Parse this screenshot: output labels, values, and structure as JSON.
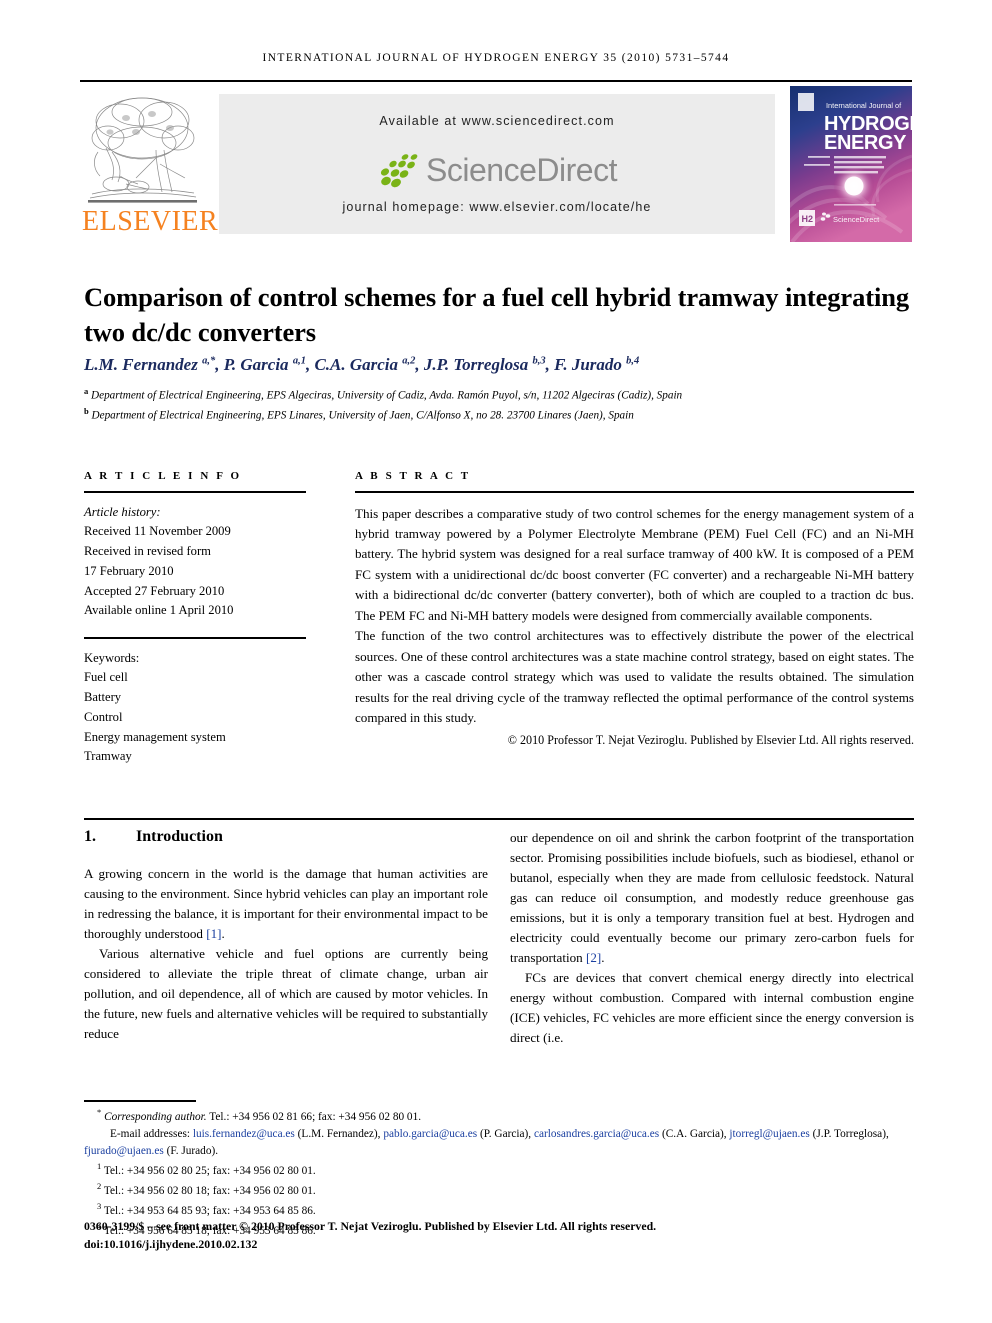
{
  "running_head": "International Journal of Hydrogen Energy 35 (2010) 5731–5744",
  "masthead": {
    "publisher_name": "ELSEVIER",
    "publisher_logo_icon": "elsevier-tree-icon",
    "available_at": "Available at www.sciencedirect.com",
    "sciencedirect_wordmark": "ScienceDirect",
    "sciencedirect_leaves_icon": "sciencedirect-leaves-icon",
    "journal_homepage": "journal homepage: www.elsevier.com/locate/he",
    "cover": {
      "eyebrow": "International Journal of",
      "line1": "HYDROGEN",
      "line2": "ENERGY",
      "badge": "H2",
      "footer_brand": "ScienceDirect"
    }
  },
  "article": {
    "title": "Comparison of control schemes for a fuel cell hybrid tramway integrating two dc/dc converters",
    "authors_html": "L.M. Fernandez <sup>a,*</sup>, P. Garcia <sup>a,1</sup>, C.A. Garcia <sup>a,2</sup>, J.P. Torreglosa <sup>b,3</sup>, F. Jurado <sup>b,4</sup>",
    "affiliation_a": "Department of Electrical Engineering, EPS Algeciras, University of Cadiz, Avda. Ramón Puyol, s/n, 11202 Algeciras (Cadiz), Spain",
    "affiliation_b": "Department of Electrical Engineering, EPS Linares, University of Jaen, C/Alfonso X, no 28. 23700 Linares (Jaen), Spain"
  },
  "article_info": {
    "heading": "A R T I C L E  I N F O",
    "history_label": "Article history:",
    "history": [
      "Received 11 November 2009",
      "Received in revised form",
      "17 February 2010",
      "Accepted 27 February 2010",
      "Available online 1 April 2010"
    ],
    "keywords_label": "Keywords:",
    "keywords": [
      "Fuel cell",
      "Battery",
      "Control",
      "Energy management system",
      "Tramway"
    ]
  },
  "abstract": {
    "heading": "A B S T R A C T",
    "paragraph1": "This paper describes a comparative study of two control schemes for the energy management system of a hybrid tramway powered by a Polymer Electrolyte Membrane (PEM) Fuel Cell (FC) and an Ni-MH battery. The hybrid system was designed for a real surface tramway of 400 kW. It is composed of a PEM FC system with a unidirectional dc/dc boost converter (FC converter) and a rechargeable Ni-MH battery with a bidirectional dc/dc converter (battery converter), both of which are coupled to a traction dc bus. The PEM FC and Ni-MH battery models were designed from commercially available components.",
    "paragraph2": "The function of the two control architectures was to effectively distribute the power of the electrical sources. One of these control architectures was a state machine control strategy, based on eight states. The other was a cascade control strategy which was used to validate the results obtained. The simulation results for the real driving cycle of the tramway reflected the optimal performance of the control systems compared in this study.",
    "copyright": "© 2010 Professor T. Nejat Veziroglu. Published by Elsevier Ltd. All rights reserved."
  },
  "body": {
    "section_number": "1.",
    "section_title": "Introduction",
    "left_p1_a": "A growing concern in the world is the damage that human activities are causing to the environment. Since hybrid vehicles can play an important role in redressing the balance, it is important for their environmental impact to be thoroughly understood ",
    "left_p1_ref": "[1]",
    "left_p1_b": ".",
    "left_p2": "Various alternative vehicle and fuel options are currently being considered to alleviate the triple threat of climate change, urban air pollution, and oil dependence, all of which are caused by motor vehicles. In the future, new fuels and alternative vehicles will be required to substantially reduce",
    "right_p1_a": "our dependence on oil and shrink the carbon footprint of the transportation sector. Promising possibilities include biofuels, such as biodiesel, ethanol or butanol, especially when they are made from cellulosic feedstock. Natural gas can reduce oil consumption, and modestly reduce greenhouse gas emissions, but it is only a temporary transition fuel at best. Hydrogen and electricity could eventually become our primary zero-carbon fuels for transportation ",
    "right_p1_ref": "[2]",
    "right_p1_b": ".",
    "right_p2": "FCs are devices that convert chemical energy directly into electrical energy without combustion. Compared with internal combustion engine (ICE) vehicles, FC vehicles are more efficient since the energy conversion is direct (i.e."
  },
  "footnotes": {
    "corresponding_italic": "Corresponding author.",
    "corresponding_rest": " Tel.: +34 956 02 81 66; fax: +34 956 02 80 01.",
    "email_label": "E-mail addresses:",
    "emails": [
      {
        "address": "luis.fernandez@uca.es",
        "owner": "(L.M. Fernandez),"
      },
      {
        "address": "pablo.garcia@uca.es",
        "owner": "(P. Garcia),"
      },
      {
        "address": "carlosandres.garcia@uca.es",
        "owner": "(C.A. Garcia),"
      },
      {
        "address": "jtorregl@ujaen.es",
        "owner": "(J.P. Torreglosa),"
      },
      {
        "address": "fjurado@ujaen.es",
        "owner": "(F. Jurado)."
      }
    ],
    "numbered": [
      {
        "num": "1",
        "text": "Tel.: +34 956 02 80 25; fax: +34 956 02 80 01."
      },
      {
        "num": "2",
        "text": "Tel.: +34 956 02 80 18; fax: +34 956 02 80 01."
      },
      {
        "num": "3",
        "text": "Tel.: +34 953 64 85 93; fax: +34 953 64 85 86."
      },
      {
        "num": "4",
        "text": "Tel.: +34 956 64 85 18; fax: +34 953 64 85 86."
      }
    ]
  },
  "imprint": {
    "line1": "0360-3199/$ – see front matter © 2010 Professor T. Nejat Veziroglu. Published by Elsevier Ltd. All rights reserved.",
    "line2": "doi:10.1016/j.ijhydene.2010.02.132"
  },
  "colors": {
    "elsevier_orange": "#F58220",
    "sciencedirect_green": "#7AB317",
    "sciencedirect_gray": "#8c8c8c",
    "link_blue": "#1a3fa0",
    "author_navy": "#1b2a5e",
    "band_gray": "#ececec"
  }
}
